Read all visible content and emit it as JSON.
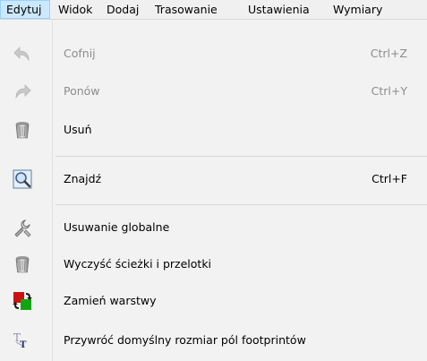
{
  "menubar": {
    "items": [
      {
        "label": "Edytuj",
        "active": true
      },
      {
        "label": "Widok"
      },
      {
        "label": "Dodaj"
      },
      {
        "label": "Trasowanie"
      },
      {
        "label": "Ustawienia"
      },
      {
        "label": "Wymiary"
      }
    ]
  },
  "menu": {
    "items": [
      {
        "label": "Cofnij",
        "shortcut": "Ctrl+Z",
        "icon": "undo-icon",
        "enabled": false
      },
      {
        "label": "Ponów",
        "shortcut": "Ctrl+Y",
        "icon": "redo-icon",
        "enabled": false
      },
      {
        "label": "Usuń",
        "shortcut": "",
        "icon": "trash-icon",
        "enabled": true
      },
      {
        "label": "Znajdź",
        "shortcut": "Ctrl+F",
        "icon": "magnifier-icon",
        "enabled": true
      },
      {
        "label": "Usuwanie globalne",
        "shortcut": "",
        "icon": "wrench-icon",
        "enabled": true
      },
      {
        "label": "Wyczyść ścieżki i przelotki",
        "shortcut": "",
        "icon": "trash-icon",
        "enabled": true
      },
      {
        "label": "Zamień warstwy",
        "shortcut": "",
        "icon": "swap-layers-icon",
        "enabled": true
      },
      {
        "label": "Przywróć domyślny rozmiar pól footprintów",
        "shortcut": "",
        "icon": "text-size-icon",
        "enabled": true
      }
    ]
  },
  "colors": {
    "menubar_bg": "#f0f0f0",
    "active_tab_bg": "#cce8ff",
    "menu_bg": "#f2f2f2",
    "disabled_text": "#8c8c8c"
  }
}
